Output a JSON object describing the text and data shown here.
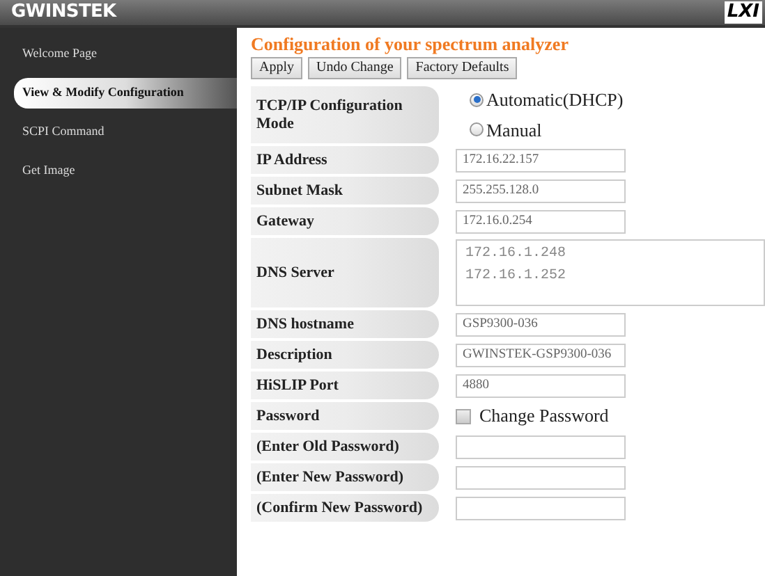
{
  "header": {
    "logo": "GWINSTEK",
    "badge": "LXI"
  },
  "sidebar": {
    "items": [
      {
        "label": "Welcome Page",
        "selected": false
      },
      {
        "label": "View & Modify Configuration",
        "selected": true
      },
      {
        "label": "SCPI Command",
        "selected": false
      },
      {
        "label": "Get Image",
        "selected": false
      }
    ]
  },
  "content": {
    "title": "Configuration of your spectrum analyzer",
    "buttons": [
      "Apply",
      "Undo Change",
      "Factory Defaults"
    ],
    "rows": [
      {
        "kind": "radio",
        "label": "TCP/IP Configuration Mode",
        "options": [
          {
            "label": "Automatic(DHCP)",
            "selected": true
          },
          {
            "label": "Manual",
            "selected": false
          }
        ]
      },
      {
        "kind": "text",
        "label": "IP Address",
        "value": "172.16.22.157"
      },
      {
        "kind": "text",
        "label": "Subnet Mask",
        "value": "255.255.128.0"
      },
      {
        "kind": "text",
        "label": "Gateway",
        "value": "172.16.0.254"
      },
      {
        "kind": "textarea",
        "label": "DNS Server",
        "value": "172.16.1.248\n172.16.1.252"
      },
      {
        "kind": "text",
        "label": "DNS hostname",
        "value": "GSP9300-036"
      },
      {
        "kind": "text",
        "label": "Description",
        "value": "GWINSTEK-GSP9300-036"
      },
      {
        "kind": "text",
        "label": "HiSLIP Port",
        "value": "4880"
      },
      {
        "kind": "checkbox",
        "label": "Password",
        "option": "Change Password",
        "checked": false
      },
      {
        "kind": "text",
        "label": "(Enter Old Password)"
      },
      {
        "kind": "text",
        "label": "(Enter New Password)"
      },
      {
        "kind": "text",
        "label": "(Confirm New Password)"
      }
    ]
  }
}
